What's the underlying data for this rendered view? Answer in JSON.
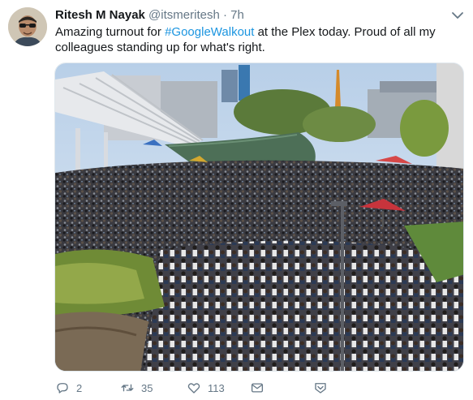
{
  "tweet": {
    "author_name": "Ritesh M Nayak",
    "handle": "@itsmeritesh",
    "separator": "·",
    "time": "7h",
    "text_before": "Amazing turnout for ",
    "hashtag": "#GoogleWalkout",
    "text_after": " at the Plex today. Proud of all my colleagues standing up for what's right."
  },
  "actions": {
    "reply_count": "2",
    "retweet_count": "35",
    "like_count": "113"
  },
  "icons": {
    "menu": "chevron-down-icon",
    "reply": "reply-icon",
    "retweet": "retweet-icon",
    "like": "heart-icon",
    "message": "envelope-icon",
    "share": "share-icon"
  },
  "colors": {
    "link": "#1b95e0",
    "secondary": "#657786"
  }
}
